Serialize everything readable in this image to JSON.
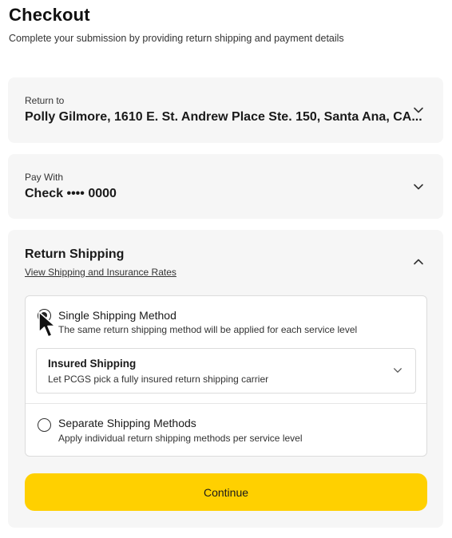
{
  "page": {
    "title": "Checkout",
    "subtitle": "Complete your submission by providing return shipping and payment details"
  },
  "return_to": {
    "label": "Return to",
    "value": "Polly Gilmore, 1610 E. St. Andrew Place Ste. 150, Santa Ana, CA..."
  },
  "pay_with": {
    "label": "Pay With",
    "value": "Check •••• 0000"
  },
  "return_shipping": {
    "title": "Return Shipping",
    "rates_link": "View Shipping and Insurance Rates",
    "options": [
      {
        "title": "Single Shipping Method",
        "description": "The same return shipping method will be applied for each service level",
        "selected": true
      },
      {
        "title": "Separate Shipping Methods",
        "description": "Apply individual return shipping methods per service level",
        "selected": false
      }
    ],
    "method_select": {
      "title": "Insured Shipping",
      "description": "Let PCGS pick a fully insured return shipping carrier"
    }
  },
  "continue_label": "Continue",
  "colors": {
    "accent": "#ffd000",
    "card_background": "#f6f6f6"
  },
  "icons": {
    "collapse": "chevron-down-icon",
    "expand": "chevron-up-icon",
    "pointer": "mouse-pointer-icon"
  }
}
